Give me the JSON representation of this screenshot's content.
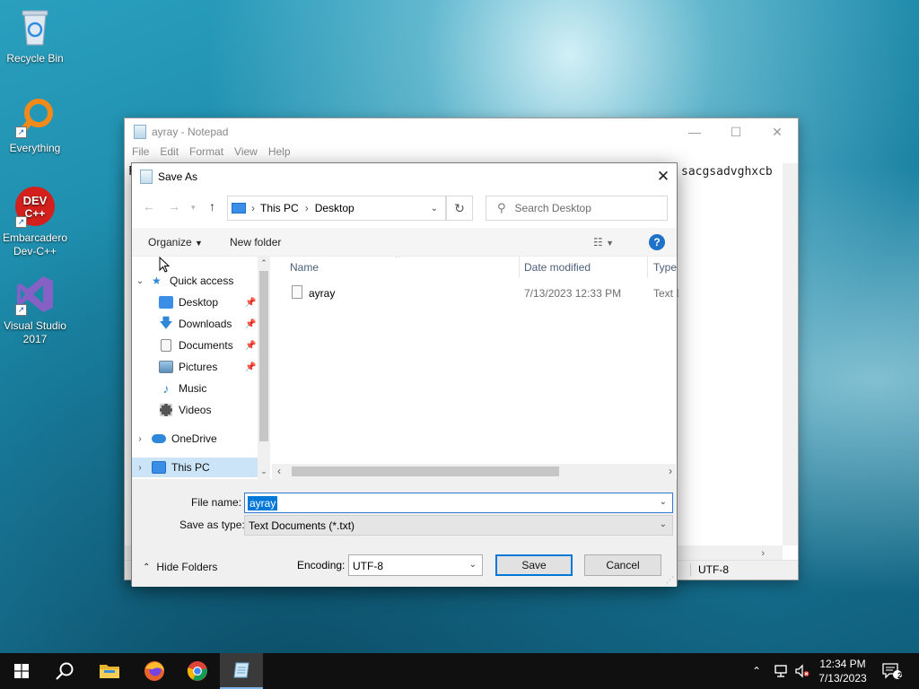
{
  "desktop": {
    "icons": [
      {
        "label": "Recycle Bin"
      },
      {
        "label": "Everything"
      },
      {
        "label": "Embarcadero Dev-C++"
      },
      {
        "label": "Visual Studio 2017"
      }
    ],
    "devcpp_logo_text": "DEV C++"
  },
  "notepad": {
    "title": "ayray - Notepad",
    "menu": [
      "File",
      "Edit",
      "Format",
      "View",
      "Help"
    ],
    "text_visible_right": "sacgsadvghxcb",
    "text_visible_left": "F",
    "status_encoding": "UTF-8"
  },
  "dialog": {
    "title": "Save As",
    "address": {
      "root": "This PC",
      "current": "Desktop"
    },
    "search_placeholder": "Search Desktop",
    "organize_label": "Organize",
    "new_folder_label": "New folder",
    "nav": {
      "quick_access": "Quick access",
      "items": [
        {
          "label": "Desktop",
          "pinned": true
        },
        {
          "label": "Downloads",
          "pinned": true
        },
        {
          "label": "Documents",
          "pinned": true
        },
        {
          "label": "Pictures",
          "pinned": true
        },
        {
          "label": "Music",
          "pinned": false
        },
        {
          "label": "Videos",
          "pinned": false
        }
      ],
      "onedrive": "OneDrive",
      "this_pc": "This PC"
    },
    "columns": {
      "name": "Name",
      "date_modified": "Date modified",
      "type": "Type"
    },
    "files": [
      {
        "name": "ayray",
        "date_modified": "7/13/2023 12:33 PM",
        "type": "Text D"
      }
    ],
    "file_name_label": "File name:",
    "file_name_value": "ayray",
    "save_as_type_label": "Save as type:",
    "save_as_type_value": "Text Documents (*.txt)",
    "hide_folders_label": "Hide Folders",
    "encoding_label": "Encoding:",
    "encoding_value": "UTF-8",
    "save_label": "Save",
    "cancel_label": "Cancel"
  },
  "taskbar": {
    "time": "12:34 PM",
    "date": "7/13/2023",
    "notifications_count": "2"
  },
  "colors": {
    "accent": "#0078d7",
    "taskbar": "#101010",
    "help_blue": "#1e72c8"
  }
}
